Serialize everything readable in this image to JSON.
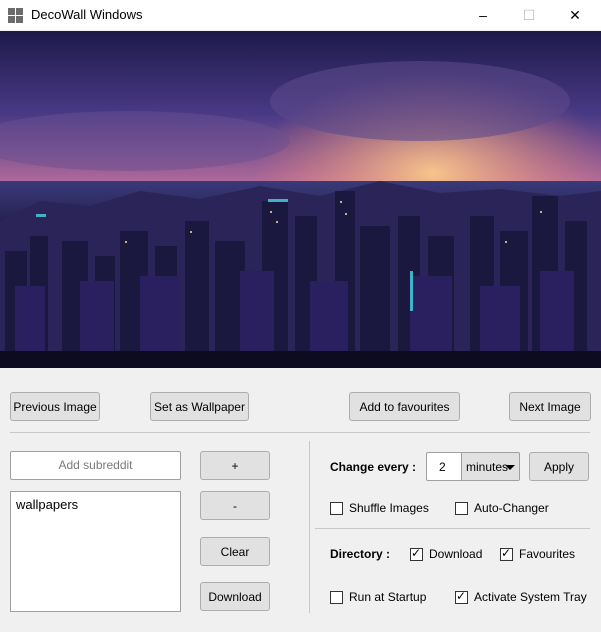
{
  "window": {
    "title": "DecoWall Windows",
    "minimize": "–",
    "maximize": "☐",
    "close": "✕"
  },
  "toolbar": {
    "previous": "Previous Image",
    "set_wallpaper": "Set as Wallpaper",
    "add_favourites": "Add to favourites",
    "next": "Next Image"
  },
  "subreddit": {
    "placeholder": "Add subreddit",
    "add": "+",
    "remove": "-",
    "clear": "Clear",
    "download": "Download",
    "items": [
      "wallpapers"
    ]
  },
  "settings": {
    "change_every_label": "Change every :",
    "interval_value": "2",
    "unit": "minutes",
    "apply": "Apply",
    "shuffle": {
      "label": "Shuffle Images",
      "checked": false
    },
    "auto_changer": {
      "label": "Auto-Changer",
      "checked": false
    },
    "directory_label": "Directory :",
    "dir_download": {
      "label": "Download",
      "checked": true
    },
    "dir_favourites": {
      "label": "Favourites",
      "checked": true
    },
    "run_startup": {
      "label": "Run at Startup",
      "checked": false
    },
    "system_tray": {
      "label": "Activate System Tray",
      "checked": true
    }
  }
}
